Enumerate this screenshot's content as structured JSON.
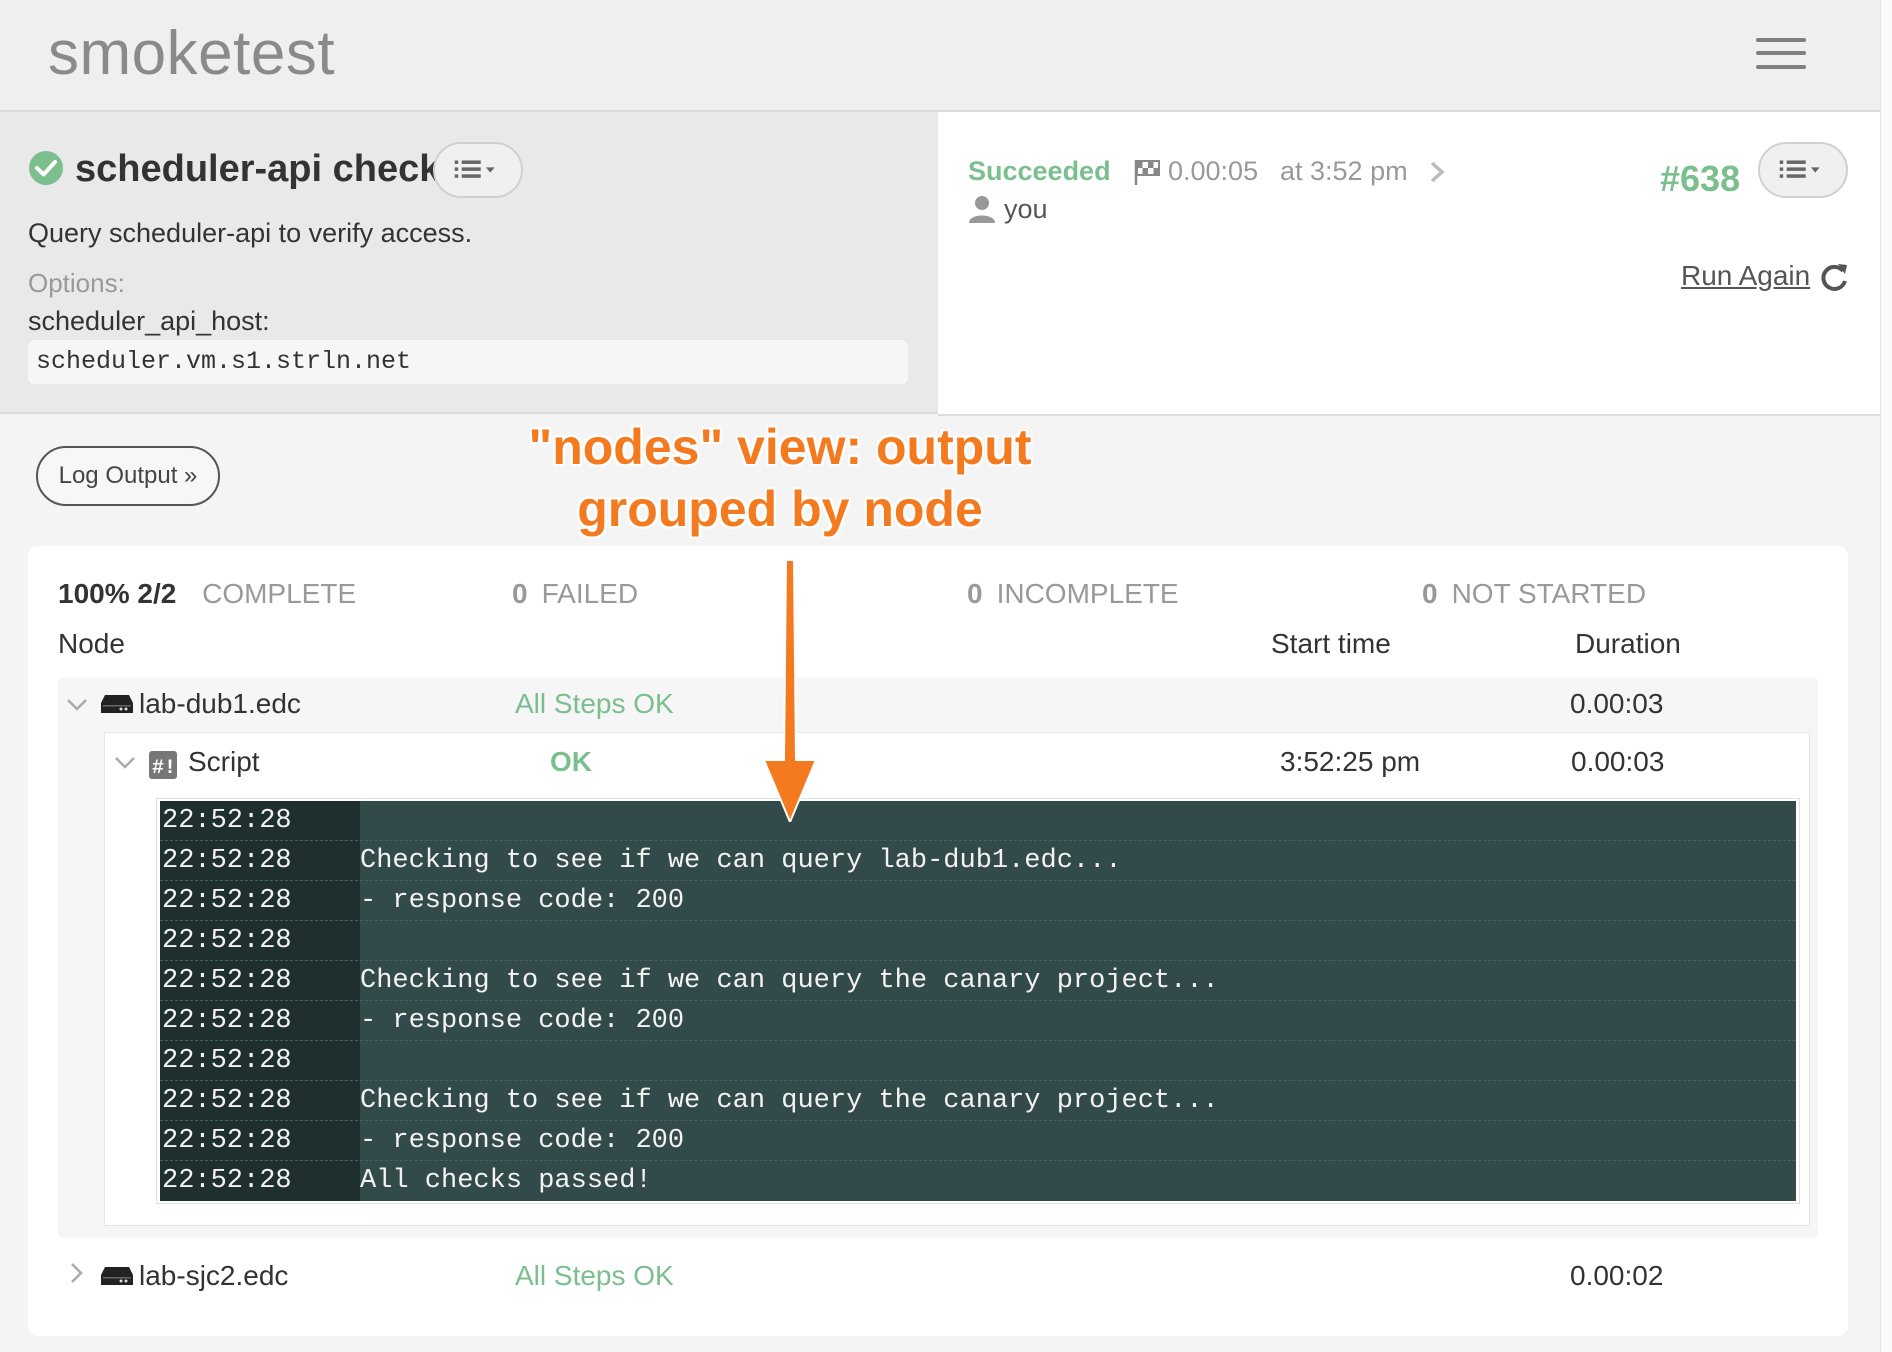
{
  "app": {
    "title": "smoketest"
  },
  "job": {
    "name": "scheduler-api check",
    "description": "Query scheduler-api to verify access.",
    "options_label": "Options:",
    "option_key": "scheduler_api_host:",
    "option_value": "scheduler.vm.s1.strln.net"
  },
  "execution": {
    "status": "Succeeded",
    "duration": "0.00:05",
    "time": "at 3:52 pm",
    "user": "you",
    "number": "#638",
    "run_again_label": "Run Again"
  },
  "log_output_button": "Log Output »",
  "annotation": {
    "line1": "\"nodes\" view: output",
    "line2": "grouped by node"
  },
  "summary": {
    "percent": "100% 2/2",
    "complete_label": "COMPLETE",
    "failed_count": "0",
    "failed_label": "FAILED",
    "incomplete_count": "0",
    "incomplete_label": "INCOMPLETE",
    "not_started_count": "0",
    "not_started_label": "NOT STARTED"
  },
  "columns": {
    "node": "Node",
    "start_time": "Start time",
    "duration": "Duration"
  },
  "nodes": [
    {
      "name": "lab-dub1.edc",
      "status": "All Steps OK",
      "duration": "0.00:03",
      "expanded": true,
      "steps": [
        {
          "name": "Script",
          "status": "OK",
          "start_time": "3:52:25 pm",
          "duration": "0.00:03",
          "log": [
            {
              "time": "22:52:28",
              "msg": ""
            },
            {
              "time": "22:52:28",
              "msg": "Checking to see if we can query lab-dub1.edc..."
            },
            {
              "time": "22:52:28",
              "msg": "- response code: 200"
            },
            {
              "time": "22:52:28",
              "msg": ""
            },
            {
              "time": "22:52:28",
              "msg": "Checking to see if we can query the canary project..."
            },
            {
              "time": "22:52:28",
              "msg": "- response code: 200"
            },
            {
              "time": "22:52:28",
              "msg": ""
            },
            {
              "time": "22:52:28",
              "msg": "Checking to see if we can query the canary project..."
            },
            {
              "time": "22:52:28",
              "msg": "- response code: 200"
            },
            {
              "time": "22:52:28",
              "msg": "All checks passed!"
            }
          ]
        }
      ]
    },
    {
      "name": "lab-sjc2.edc",
      "status": "All Steps OK",
      "duration": "0.00:02",
      "expanded": false
    }
  ],
  "colors": {
    "success": "#7bbf8e",
    "console_bg": "#334a4b",
    "annotation": "#f37a1f"
  },
  "icons": [
    "check-circle-icon",
    "list-menu-icon",
    "flag-icon",
    "chevron-right-icon",
    "user-icon",
    "refresh-icon",
    "chevron-down-icon",
    "server-icon",
    "script-icon",
    "hamburger-menu-icon"
  ]
}
